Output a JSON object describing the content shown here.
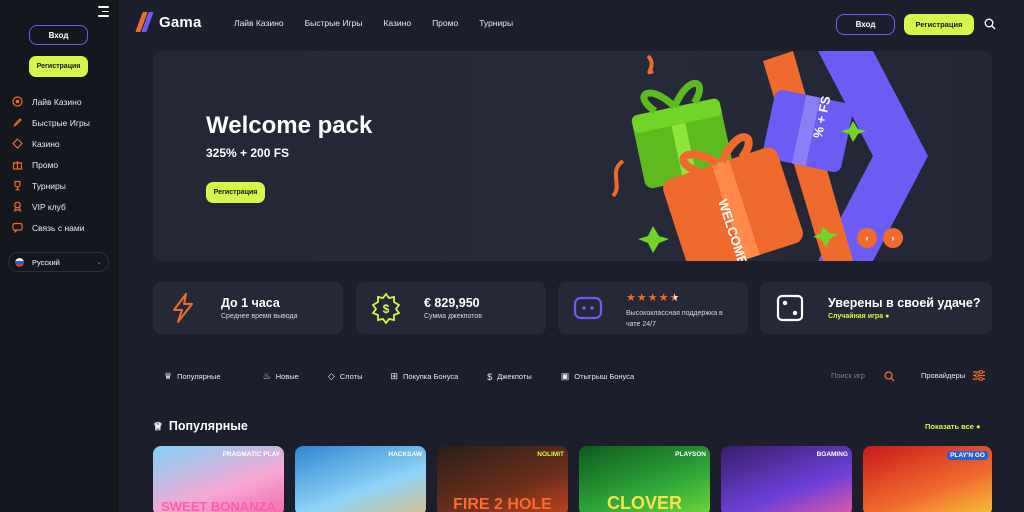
{
  "sidebar": {
    "login_label": "Вход",
    "register_label": "Регистрация",
    "items": [
      {
        "label": "Лайв Казино",
        "icon": "live-casino-icon"
      },
      {
        "label": "Быстрые Игры",
        "icon": "rocket-icon"
      },
      {
        "label": "Казино",
        "icon": "casino-icon"
      },
      {
        "label": "Промо",
        "icon": "gift-icon"
      },
      {
        "label": "Турниры",
        "icon": "trophy-icon"
      },
      {
        "label": "VIP клуб",
        "icon": "vip-icon"
      },
      {
        "label": "Связь с нами",
        "icon": "chat-icon"
      }
    ],
    "language": "Русский"
  },
  "header": {
    "logo_text": "Gama",
    "nav": [
      "Лайв Казино",
      "Быстрые Игры",
      "Казино",
      "Промо",
      "Турниры"
    ],
    "login_label": "Вход",
    "register_label": "Регистрация"
  },
  "banner": {
    "title": "Welcome pack",
    "subtitle": "325% + 200 FS",
    "register_label": "Регистрация",
    "gift_text_1": "WELCOME",
    "gift_text_2": "% + FS",
    "prev_arrow": "‹",
    "next_arrow": "›"
  },
  "cards": [
    {
      "title": "До 1 часа",
      "subtitle": "Среднее время вывода",
      "icon": "lightning-icon"
    },
    {
      "title": "€ 829,950",
      "subtitle": "Сумма джекпотов",
      "icon": "jackpot-dollar-icon"
    },
    {
      "stars": 4.5,
      "subtitle": "Высококлассная поддержка в чате 24/7",
      "icon": "chat-support-icon"
    },
    {
      "title": "Уверены в своей удаче?",
      "link": "Случайная игра",
      "icon": "dice-icon"
    }
  ],
  "filters": [
    {
      "label": "Популярные",
      "icon": "crown-icon"
    },
    {
      "label": "Новые",
      "icon": "fire-icon"
    },
    {
      "label": "Слоты",
      "icon": "diamond-icon"
    },
    {
      "label": "Покупка Бонуса",
      "icon": "bonus-buy-icon"
    },
    {
      "label": "Джекпоты",
      "icon": "jackpot-icon"
    },
    {
      "label": "Отыгрыш Бонуса",
      "icon": "wager-icon"
    }
  ],
  "search": {
    "placeholder": "Поиск игр"
  },
  "providers_label": "Провайдеры",
  "popular": {
    "title": "Популярные",
    "show_all": "Показать все"
  },
  "games": [
    {
      "title": "SWEET BONANZA",
      "provider": "PRAGMATIC PLAY"
    },
    {
      "title": "",
      "provider": "HACKSAW"
    },
    {
      "title": "FIRE 2 HOLE",
      "provider": "NOLIMIT"
    },
    {
      "title": "CLOVER",
      "provider": "PLAYSON"
    },
    {
      "title": "",
      "provider": "BGAMING"
    },
    {
      "title": "",
      "provider": "PLAY'N GO"
    }
  ],
  "colors": {
    "accent_lime": "#d6f74a",
    "accent_orange": "#f06a2e",
    "accent_purple": "#6b5cf6",
    "background": "#1c1f2b",
    "sidebar": "#15171f",
    "card": "#252937"
  }
}
